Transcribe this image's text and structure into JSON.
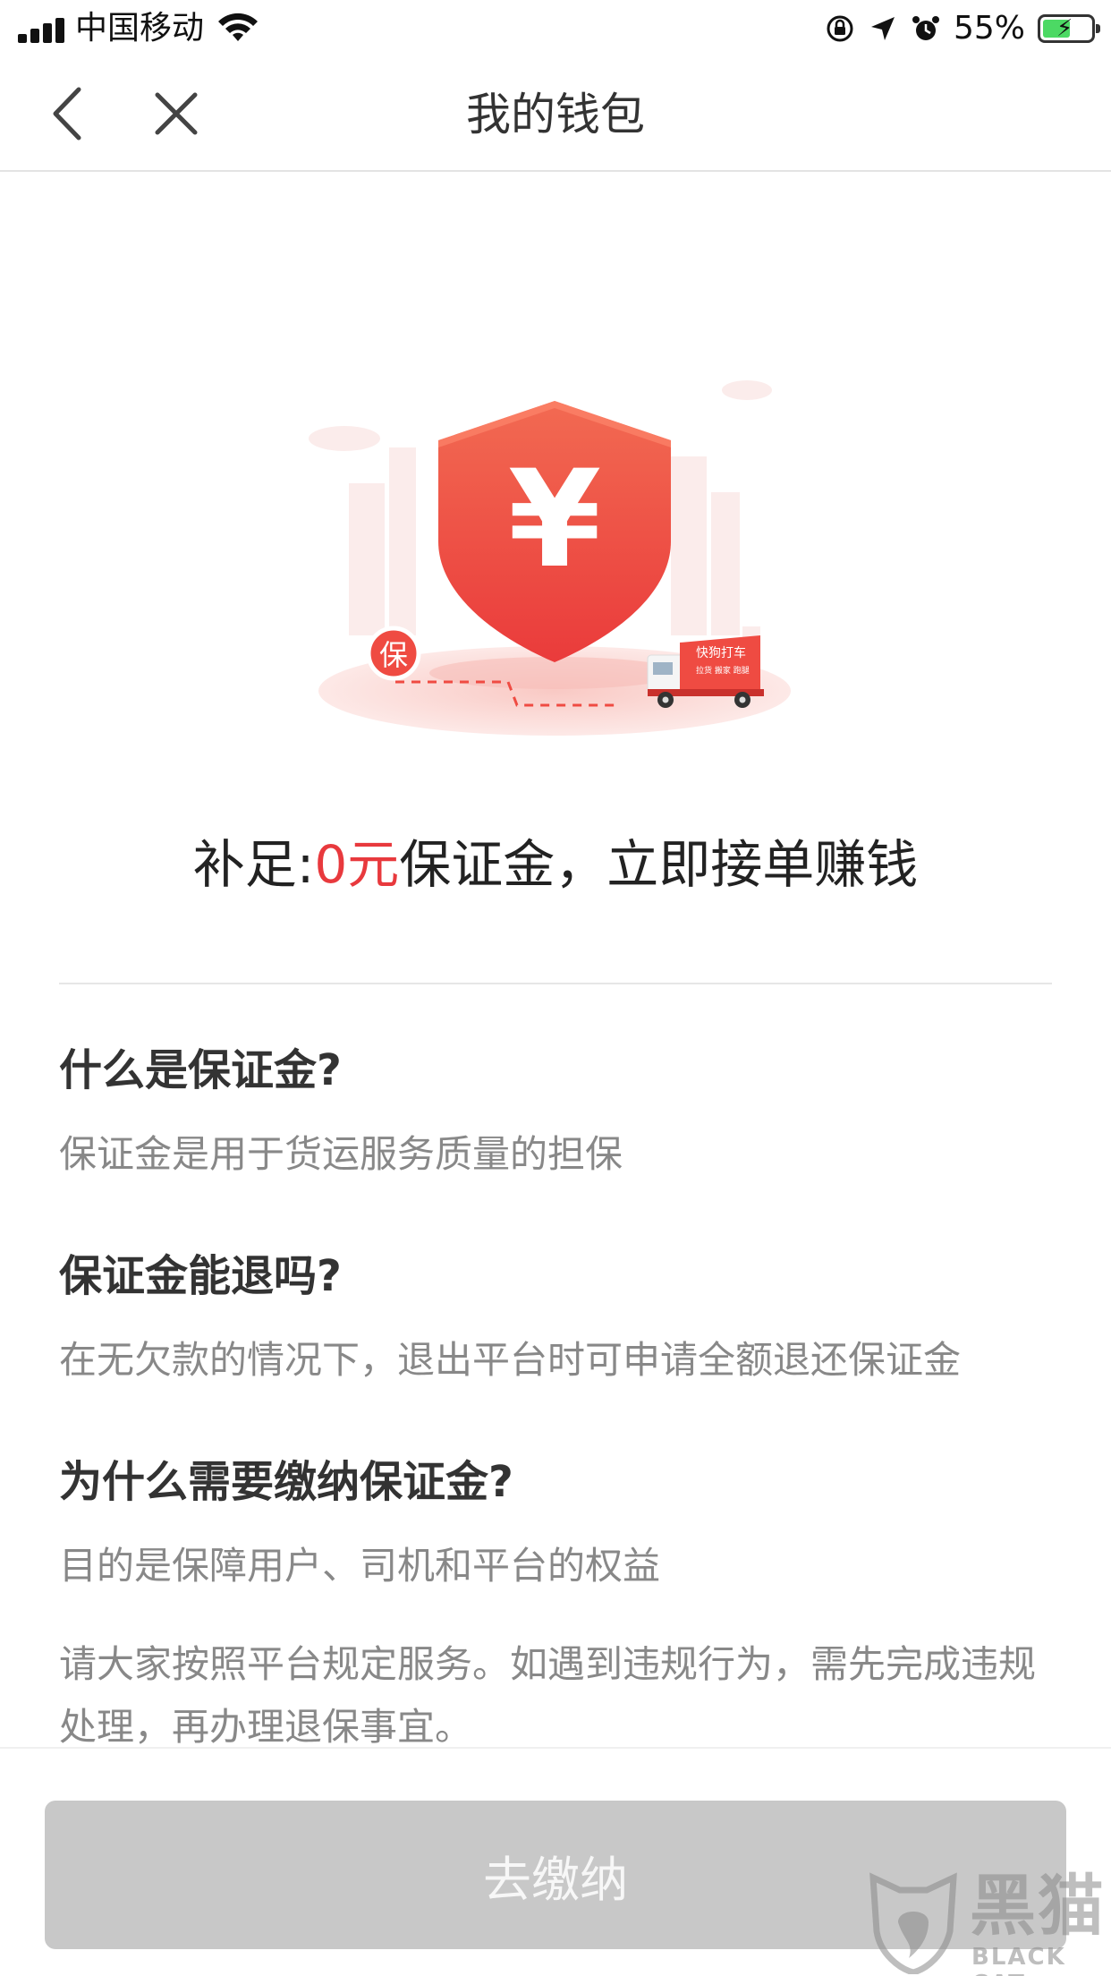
{
  "status_bar": {
    "carrier": "中国移动",
    "battery_percent": "55%"
  },
  "nav": {
    "title": "我的钱包"
  },
  "illustration": {
    "currency_symbol": "¥",
    "badge_label": "保",
    "truck_label": "快狗打车",
    "truck_sublabel": "拉货 搬家 跑腿",
    "colors": {
      "accent": "#f0483e",
      "light": "#fbe3e1"
    }
  },
  "headline": {
    "prefix": "补足:",
    "amount": "0元",
    "suffix": "保证金，立即接单赚钱"
  },
  "faq": [
    {
      "question": "什么是保证金?",
      "answer": "保证金是用于货运服务质量的担保"
    },
    {
      "question": "保证金能退吗?",
      "answer": "在无欠款的情况下，退出平台时可申请全额退还保证金"
    },
    {
      "question": "为什么需要缴纳保证金?",
      "answer": "目的是保障用户、司机和平台的权益"
    }
  ],
  "note": "请大家按照平台规定服务。如遇到违规行为，需先完成违规处理，再办理退保事宜。",
  "action": {
    "pay_label": "去缴纳"
  },
  "watermark": {
    "text": "黑猫",
    "sub": "BLACK CAT"
  }
}
